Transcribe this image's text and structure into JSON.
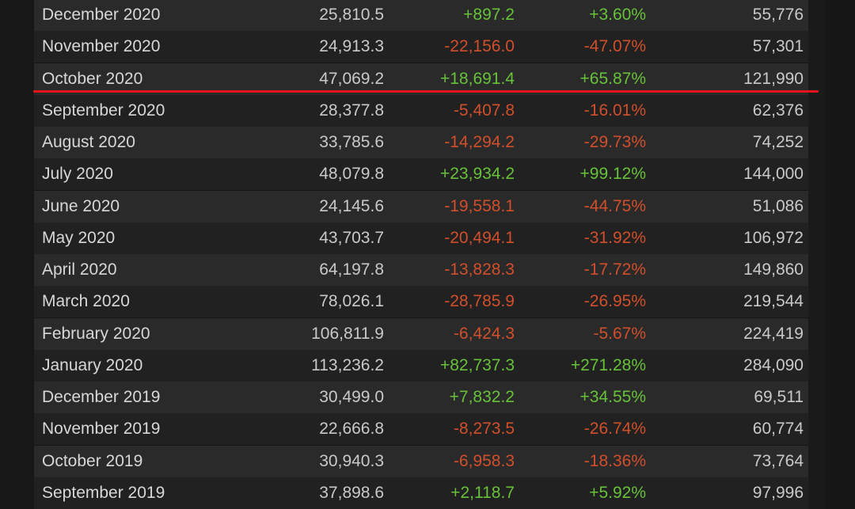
{
  "table": {
    "rows": [
      {
        "month": "December 2020",
        "avg": "25,810.5",
        "gain": "+897.2",
        "pct": "+3.60%",
        "peak": "55,776",
        "trend": "pos"
      },
      {
        "month": "November 2020",
        "avg": "24,913.3",
        "gain": "-22,156.0",
        "pct": "-47.07%",
        "peak": "57,301",
        "trend": "neg"
      },
      {
        "month": "October 2020",
        "avg": "47,069.2",
        "gain": "+18,691.4",
        "pct": "+65.87%",
        "peak": "121,990",
        "trend": "pos"
      },
      {
        "month": "September 2020",
        "avg": "28,377.8",
        "gain": "-5,407.8",
        "pct": "-16.01%",
        "peak": "62,376",
        "trend": "neg"
      },
      {
        "month": "August 2020",
        "avg": "33,785.6",
        "gain": "-14,294.2",
        "pct": "-29.73%",
        "peak": "74,252",
        "trend": "neg"
      },
      {
        "month": "July 2020",
        "avg": "48,079.8",
        "gain": "+23,934.2",
        "pct": "+99.12%",
        "peak": "144,000",
        "trend": "pos"
      },
      {
        "month": "June 2020",
        "avg": "24,145.6",
        "gain": "-19,558.1",
        "pct": "-44.75%",
        "peak": "51,086",
        "trend": "neg"
      },
      {
        "month": "May 2020",
        "avg": "43,703.7",
        "gain": "-20,494.1",
        "pct": "-31.92%",
        "peak": "106,972",
        "trend": "neg"
      },
      {
        "month": "April 2020",
        "avg": "64,197.8",
        "gain": "-13,828.3",
        "pct": "-17.72%",
        "peak": "149,860",
        "trend": "neg"
      },
      {
        "month": "March 2020",
        "avg": "78,026.1",
        "gain": "-28,785.9",
        "pct": "-26.95%",
        "peak": "219,544",
        "trend": "neg"
      },
      {
        "month": "February 2020",
        "avg": "106,811.9",
        "gain": "-6,424.3",
        "pct": "-5.67%",
        "peak": "224,419",
        "trend": "neg"
      },
      {
        "month": "January 2020",
        "avg": "113,236.2",
        "gain": "+82,737.3",
        "pct": "+271.28%",
        "peak": "284,090",
        "trend": "pos"
      },
      {
        "month": "December 2019",
        "avg": "30,499.0",
        "gain": "+7,832.2",
        "pct": "+34.55%",
        "peak": "69,511",
        "trend": "pos"
      },
      {
        "month": "November 2019",
        "avg": "22,666.8",
        "gain": "-8,273.5",
        "pct": "-26.74%",
        "peak": "60,774",
        "trend": "neg"
      },
      {
        "month": "October 2019",
        "avg": "30,940.3",
        "gain": "-6,958.3",
        "pct": "-18.36%",
        "peak": "73,764",
        "trend": "neg"
      },
      {
        "month": "September 2019",
        "avg": "37,898.6",
        "gain": "+2,118.7",
        "pct": "+5.92%",
        "peak": "97,996",
        "trend": "pos"
      }
    ]
  },
  "colors": {
    "positive": "#67c23a",
    "negative": "#d14f2b",
    "highlight_line": "#e8141c",
    "row_even": "#2a2a2a",
    "row_odd": "#212121"
  }
}
